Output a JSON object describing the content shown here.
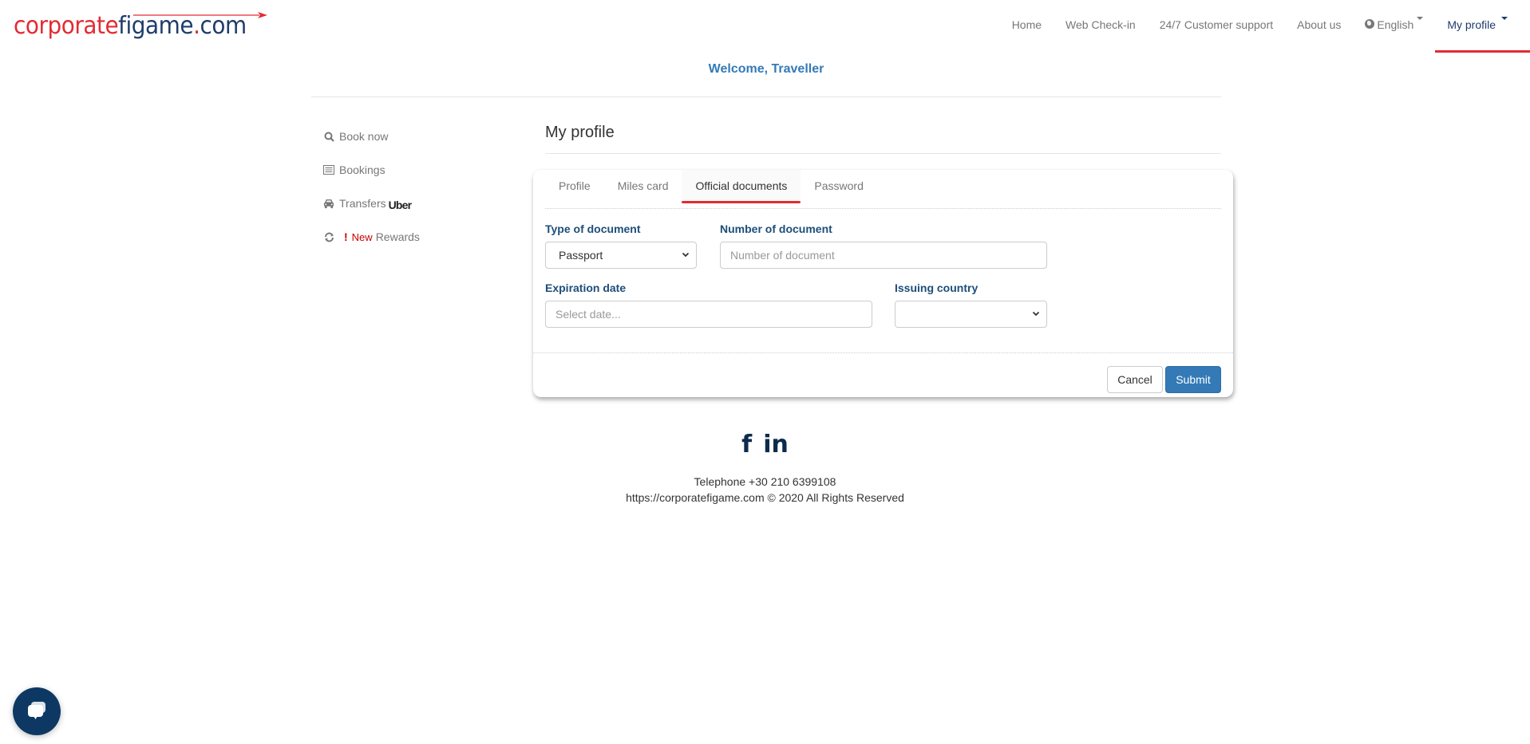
{
  "brand": {
    "logo_part1": "corporate",
    "logo_part2": "figame",
    "logo_part3": ".com",
    "colors": {
      "red": "#e42a33",
      "navy": "#1f3c6b",
      "link_blue": "#337ab7"
    }
  },
  "nav": {
    "items": [
      {
        "label": "Home"
      },
      {
        "label": "Web Check-in"
      },
      {
        "label": "24/7 Customer support"
      },
      {
        "label": "About us"
      },
      {
        "label": "English",
        "icon": "globe-icon"
      },
      {
        "label": "My profile",
        "active": true
      }
    ]
  },
  "welcome": "Welcome, Traveller",
  "sidebar": {
    "items": [
      {
        "label": "Book now",
        "icon": "search-icon"
      },
      {
        "label": "Bookings",
        "icon": "list-icon"
      },
      {
        "label": "Transfers",
        "icon": "taxi-icon",
        "badge": "Uber"
      },
      {
        "label": "Rewards",
        "icon": "refresh-icon",
        "alert": "!",
        "new_label": "New"
      }
    ]
  },
  "main": {
    "title": "My profile",
    "tabs": [
      {
        "label": "Profile"
      },
      {
        "label": "Miles card"
      },
      {
        "label": "Official documents",
        "active": true
      },
      {
        "label": "Password"
      }
    ],
    "form": {
      "type_of_document": {
        "label": "Type of document",
        "value": "Passport"
      },
      "number_of_document": {
        "label": "Number of document",
        "value": "",
        "placeholder": "Number of document"
      },
      "expiration_date": {
        "label": "Expiration date",
        "value": "",
        "placeholder": "Select date..."
      },
      "issuing_country": {
        "label": "Issuing country",
        "value": ""
      }
    },
    "buttons": {
      "cancel": "Cancel",
      "submit": "Submit"
    }
  },
  "footer": {
    "social": [
      {
        "label": "f",
        "icon": "facebook-icon"
      },
      {
        "label": "in",
        "icon": "linkedin-icon"
      }
    ],
    "telephone": "Telephone +30 210 6399108",
    "copyright": "https://corporatefigame.com © 2020 All Rights Reserved"
  },
  "chat": {
    "icon": "chat-icon"
  }
}
